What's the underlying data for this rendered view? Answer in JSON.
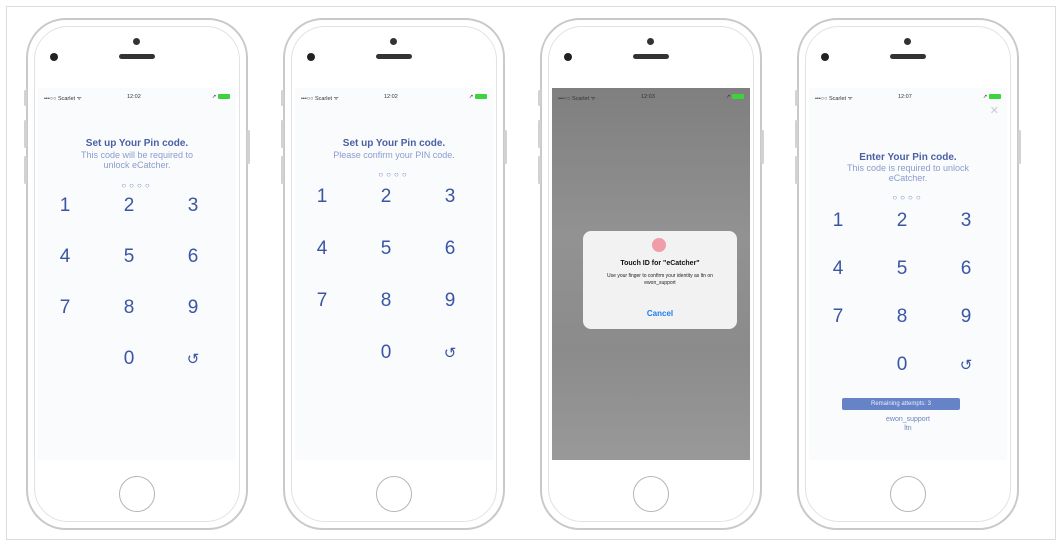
{
  "phones": [
    {
      "status": {
        "carrier": "•••○○ Scarlet ᯤ",
        "time": "12:02"
      },
      "title": "Set up Your Pin code.",
      "subtitle": "This code will be required to unlock eCatcher.",
      "dots": "○○○○",
      "keys": [
        "1",
        "2",
        "3",
        "4",
        "5",
        "6",
        "7",
        "8",
        "9",
        "0",
        "↺"
      ]
    },
    {
      "status": {
        "carrier": "•••○○ Scarlet ᯤ",
        "time": "12:02"
      },
      "title": "Set up Your Pin code.",
      "subtitle": "Please confirm your PIN code.",
      "dots": "○○○○",
      "keys": [
        "1",
        "2",
        "3",
        "4",
        "5",
        "6",
        "7",
        "8",
        "9",
        "0",
        "↺"
      ]
    },
    {
      "status": {
        "carrier": "•••○○ Scarlet ᯤ",
        "time": "12:03"
      },
      "dialog": {
        "title": "Touch ID for \"eCatcher\"",
        "body": "Use your finger to confirm your identity as ltn on ewon_support",
        "cancel": "Cancel"
      }
    },
    {
      "status": {
        "carrier": "•••○○ Scarlet ᯤ",
        "time": "12:07"
      },
      "close": "✕",
      "title": "Enter Your Pin code.",
      "subtitle": "This code is required to unlock eCatcher.",
      "dots": "○○○○",
      "keys": [
        "1",
        "2",
        "3",
        "4",
        "5",
        "6",
        "7",
        "8",
        "9",
        "0",
        "↺"
      ],
      "attempts": "Remaining attempts: 3",
      "user": "ewon_support",
      "site": "ltn"
    }
  ],
  "icons": {
    "battery": "battery-icon",
    "location": "location-arrow-icon",
    "home": "home-button-icon"
  },
  "colors": {
    "accent": "#3a55a4",
    "badge": "#6683c8",
    "cancel": "#1e7cf2"
  }
}
